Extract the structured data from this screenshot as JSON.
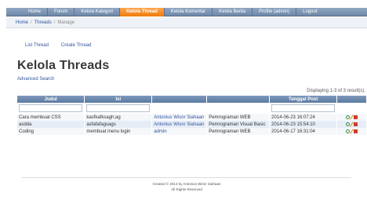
{
  "nav": {
    "items": [
      {
        "label": "Home",
        "active": false
      },
      {
        "label": "Forum",
        "active": false
      },
      {
        "label": "Kelola Kategori",
        "active": false
      },
      {
        "label": "Kelola Thread",
        "active": true
      },
      {
        "label": "Kelola Komentar",
        "active": false
      },
      {
        "label": "Kelola Berita",
        "active": false
      },
      {
        "label": "Profile (admin)",
        "active": false
      },
      {
        "label": "Logout",
        "active": false
      }
    ]
  },
  "breadcrumb": {
    "home": "Home",
    "threads": "Threads",
    "current": "Manage",
    "separator": "/"
  },
  "subnav": {
    "list": "List Thread",
    "create": "Create Thread"
  },
  "page_title": "Kelola Threads",
  "advanced_search": "Advanced Search",
  "summary": "Displaying 1-3 of 3 result(s).",
  "grid": {
    "headers": [
      "Judul",
      "Isi",
      "",
      "",
      "Tanggal Post",
      ""
    ],
    "rows": [
      {
        "judul": "Cara membuat CSS",
        "isi": "kasfkafksagh;ag",
        "user": "Antonius Wisnr Siahaan",
        "kategori": "Pemrograman WEB",
        "tanggal": "2014-06-23 16:07:24"
      },
      {
        "judul": "asdda",
        "isi": "asfafafagsags",
        "user": "Antonius Wisnr Siahaan",
        "kategori": "Pemrograman Visual Basic",
        "tanggal": "2014-06-23 15:54:10"
      },
      {
        "judul": "Coding",
        "isi": "membuat menu login",
        "user": "admin",
        "kategori": "Pemrograman WEB",
        "tanggal": "2014-06-17 16:31:04"
      }
    ],
    "row_actions": [
      "view-icon",
      "edit-icon",
      "delete-icon"
    ]
  },
  "footer": {
    "line1": "Created © 2014 by Antonius Wisnr Siahaan",
    "line2": "All Rights Reserved"
  },
  "colors": {
    "nav_bg": "#7a93b4",
    "nav_active": "#f58a1f",
    "link": "#31559d",
    "grid_header": "#6a86ab"
  }
}
